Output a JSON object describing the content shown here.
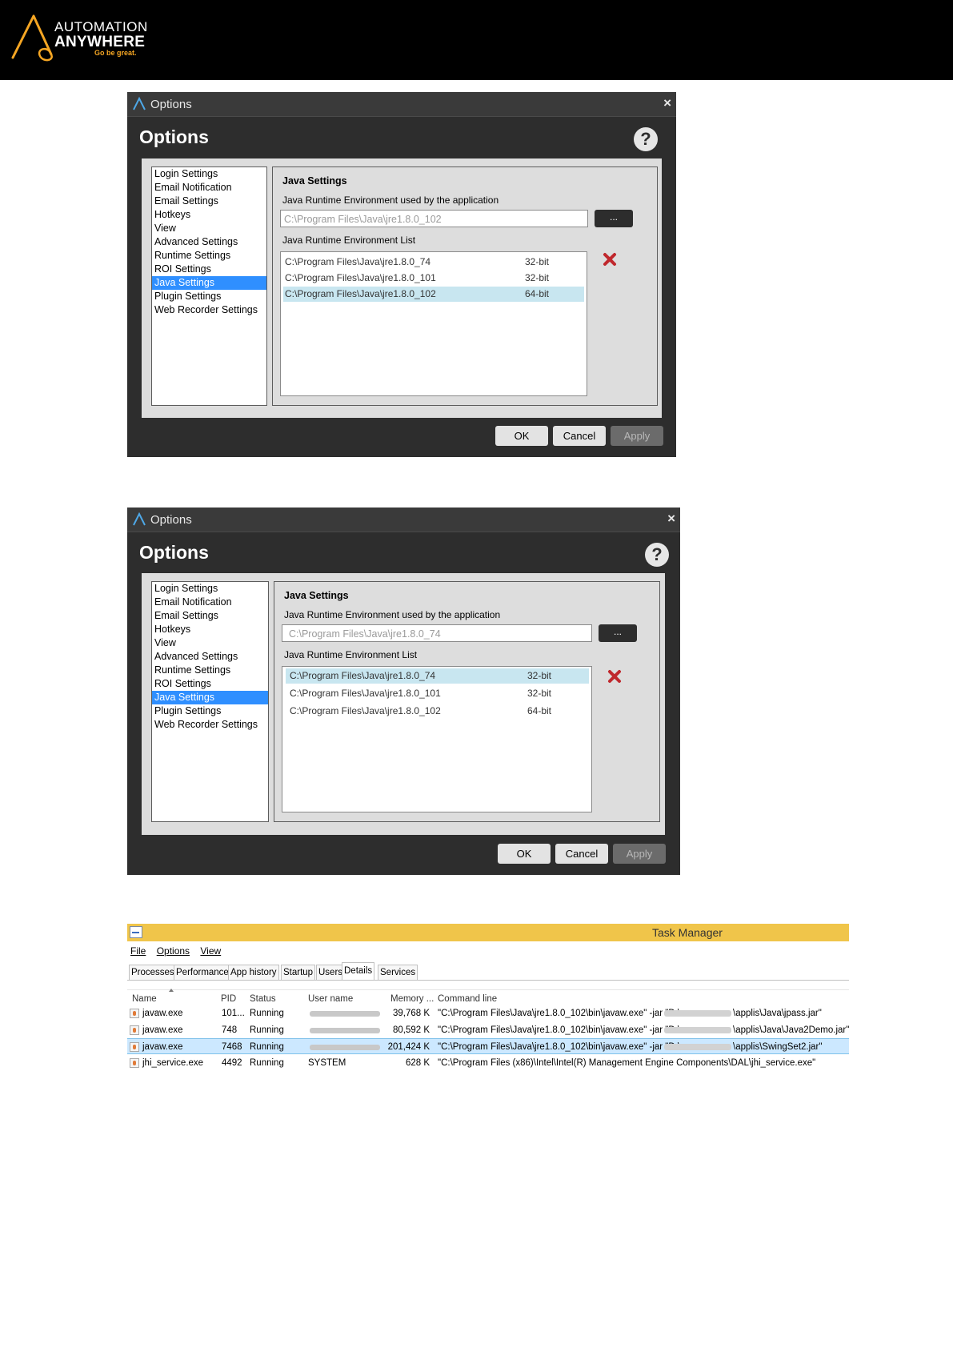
{
  "header": {
    "logo_line1": "AUTOMATION",
    "logo_line2": "ANYWHERE",
    "tagline": "Go be great."
  },
  "options_dialog_1": {
    "window_title": "Options",
    "heading": "Options",
    "close_glyph": "×",
    "help_glyph": "?",
    "nav_items": [
      "Login Settings",
      "Email Notification",
      "Email Settings",
      "Hotkeys",
      "View",
      "Advanced Settings",
      "Runtime Settings",
      "ROI Settings",
      "Java Settings",
      "Plugin Settings",
      "Web Recorder Settings"
    ],
    "selected_nav": "Java Settings",
    "panel_title": "Java Settings",
    "jre_used_label": "Java Runtime Environment used by the application",
    "jre_used_value": "C:\\Program Files\\Java\\jre1.8.0_102",
    "browse_label": "...",
    "jre_list_label": "Java Runtime Environment List",
    "jre_list": [
      {
        "path": "C:\\Program Files\\Java\\jre1.8.0_74",
        "bits": "32-bit"
      },
      {
        "path": "C:\\Program Files\\Java\\jre1.8.0_101",
        "bits": "32-bit"
      },
      {
        "path": "C:\\Program Files\\Java\\jre1.8.0_102",
        "bits": "64-bit",
        "selected": true
      }
    ],
    "buttons": {
      "ok": "OK",
      "cancel": "Cancel",
      "apply": "Apply"
    }
  },
  "options_dialog_2": {
    "window_title": "Options",
    "heading": "Options",
    "close_glyph": "×",
    "help_glyph": "?",
    "nav_items": [
      "Login Settings",
      "Email Notification",
      "Email Settings",
      "Hotkeys",
      "View",
      "Advanced Settings",
      "Runtime Settings",
      "ROI Settings",
      "Java Settings",
      "Plugin Settings",
      "Web Recorder Settings"
    ],
    "selected_nav": "Java Settings",
    "panel_title": "Java Settings",
    "jre_used_label": "Java Runtime Environment used by the application",
    "jre_used_value": "C:\\Program Files\\Java\\jre1.8.0_74",
    "browse_label": "...",
    "jre_list_label": "Java Runtime Environment List",
    "jre_list": [
      {
        "path": "C:\\Program Files\\Java\\jre1.8.0_74",
        "bits": "32-bit",
        "selected": true
      },
      {
        "path": "C:\\Program Files\\Java\\jre1.8.0_101",
        "bits": "32-bit"
      },
      {
        "path": "C:\\Program Files\\Java\\jre1.8.0_102",
        "bits": "64-bit"
      }
    ],
    "buttons": {
      "ok": "OK",
      "cancel": "Cancel",
      "apply": "Apply"
    }
  },
  "task_manager": {
    "title": "Task Manager",
    "menu": [
      "File",
      "Options",
      "View"
    ],
    "tabs": [
      "Processes",
      "Performance",
      "App history",
      "Startup",
      "Users",
      "Details",
      "Services"
    ],
    "active_tab": "Details",
    "columns": [
      "Name",
      "PID",
      "Status",
      "User name",
      "Memory ...",
      "Command line"
    ],
    "rows": [
      {
        "name": "javaw.exe",
        "pid": "101...",
        "status": "Running",
        "user": "",
        "memory": "39,768 K",
        "cmd_pre": "\"C:\\Program Files\\Java\\jre1.8.0_102\\bin\\javaw.exe\" -jar \"D:\\",
        "cmd_post": "\\applis\\Java\\jpass.jar\""
      },
      {
        "name": "javaw.exe",
        "pid": "748",
        "status": "Running",
        "user": "",
        "memory": "80,592 K",
        "cmd_pre": "\"C:\\Program Files\\Java\\jre1.8.0_102\\bin\\javaw.exe\" -jar \"D:\\",
        "cmd_post": "\\applis\\Java\\Java2Demo.jar\""
      },
      {
        "name": "javaw.exe",
        "pid": "7468",
        "status": "Running",
        "user": "",
        "memory": "201,424 K",
        "cmd_pre": "\"C:\\Program Files\\Java\\jre1.8.0_102\\bin\\javaw.exe\" -jar \"D:\\",
        "cmd_post": "\\applis\\SwingSet2.jar\"",
        "selected": true
      },
      {
        "name": "jhi_service.exe",
        "pid": "4492",
        "status": "Running",
        "user": "SYSTEM",
        "memory": "628 K",
        "cmd_pre": "\"C:\\Program Files (x86)\\Intel\\Intel(R) Management Engine Components\\DAL\\jhi_service.exe\"",
        "cmd_post": ""
      }
    ]
  },
  "colors": {
    "header_bg": "#000000",
    "logo_accent": "#f5a623",
    "dialog_bg": "#2d2d2d",
    "nav_selected": "#2f8fff",
    "list_selected": "#c8e6f0",
    "delete_icon": "#c0282d",
    "taskmanager_titlebar": "#f0c54a",
    "taskmanager_selected_row": "#cce8ff"
  }
}
